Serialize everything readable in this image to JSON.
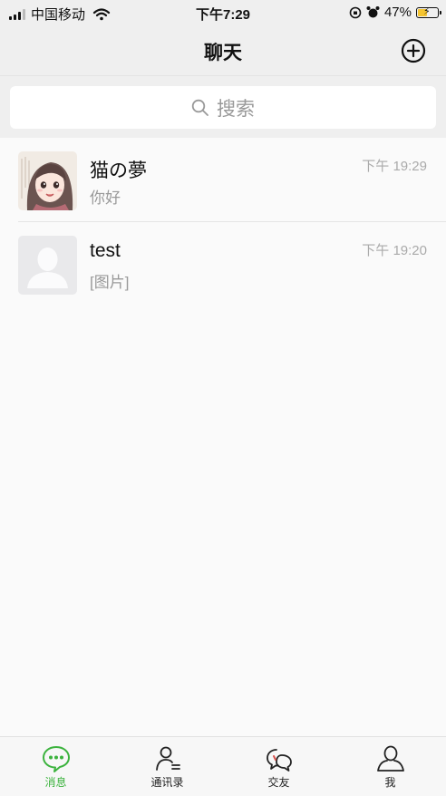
{
  "status_bar": {
    "carrier": "中国移动",
    "time": "下午7:29",
    "battery": "47%",
    "battery_level": 0.47
  },
  "header": {
    "title": "聊天",
    "add_icon": "plus-circle-icon"
  },
  "search": {
    "placeholder": "搜索"
  },
  "chats": [
    {
      "name": "猫の夢",
      "preview": "你好",
      "time": "下午 19:29",
      "avatar": "anime-avatar"
    },
    {
      "name": "test",
      "preview": "[图片]",
      "time": "下午 19:20",
      "avatar": "default-avatar"
    }
  ],
  "tabs": [
    {
      "label": "消息",
      "icon": "chat-bubble-icon",
      "active": true
    },
    {
      "label": "通讯录",
      "icon": "contacts-icon",
      "active": false
    },
    {
      "label": "交友",
      "icon": "friends-icon",
      "active": false
    },
    {
      "label": "我",
      "icon": "profile-icon",
      "active": false
    }
  ],
  "colors": {
    "accent": "#3cb33e",
    "battery": "#f4c431"
  }
}
